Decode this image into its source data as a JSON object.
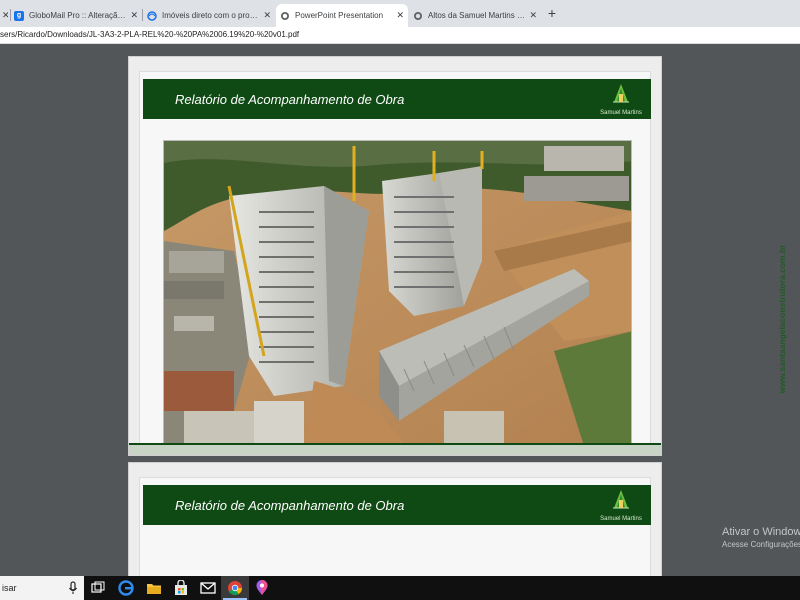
{
  "tabs": [
    {
      "label": "GloboMail Pro :: Alteração de se",
      "icon": "globomail-favicon",
      "active": false
    },
    {
      "label": "Imóveis direto com o proprietário",
      "icon": "site-favicon",
      "active": false
    },
    {
      "label": "PowerPoint Presentation",
      "icon": "globe-icon",
      "active": true
    },
    {
      "label": "Altos da Samuel Martins - Santa",
      "icon": "globe-icon",
      "active": false
    }
  ],
  "address_bar": {
    "url": "sers/Ricardo/Downloads/JL-3A3-2-PLA-REL%20-%20PA%2006.19%20-%20v01.pdf"
  },
  "pdf": {
    "pages": [
      {
        "title": "Relatório de Acompanhamento de Obra",
        "logo_text": "Samuel Martins",
        "side_url": "www.santaangelaconstrutora.com.br"
      },
      {
        "title": "Relatório de Acompanhamento de Obra",
        "logo_text": "Samuel Martins"
      }
    ]
  },
  "watermark": {
    "line1": "Ativar o Windows",
    "line2": "Acesse Configurações"
  },
  "taskbar": {
    "search_text": "isar"
  },
  "colors": {
    "banner_green": "#0f4a14",
    "viewer_bg": "#525659"
  }
}
